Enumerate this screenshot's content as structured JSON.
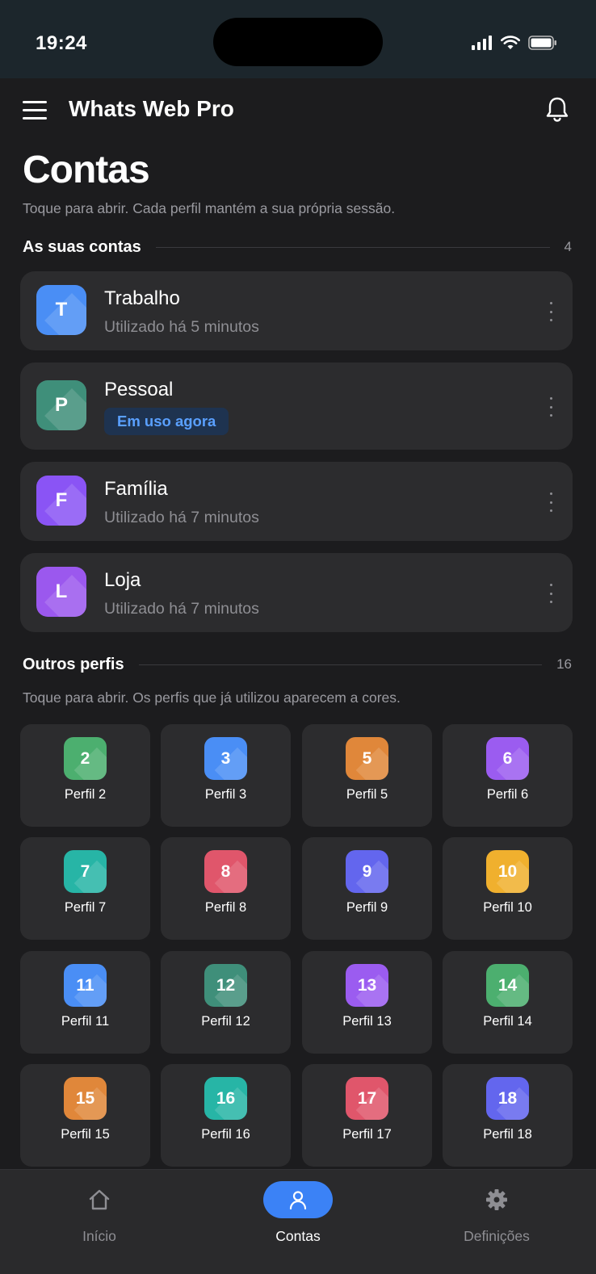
{
  "status_bar": {
    "time": "19:24"
  },
  "app": {
    "title": "Whats Web Pro"
  },
  "page": {
    "title": "Contas",
    "subtitle": "Toque para abrir. Cada perfil mantém a sua própria sessão."
  },
  "accounts_section": {
    "title": "As suas contas",
    "count": "4",
    "items": [
      {
        "initial": "T",
        "name": "Trabalho",
        "meta": "Utilizado há 5 minutos",
        "color": "#4a8ef5"
      },
      {
        "initial": "P",
        "name": "Pessoal",
        "badge": "Em uso agora",
        "color": "#3f8f7a"
      },
      {
        "initial": "F",
        "name": "Família",
        "meta": "Utilizado há 7 minutos",
        "color": "#8a54f5"
      },
      {
        "initial": "L",
        "name": "Loja",
        "meta": "Utilizado há 7 minutos",
        "color": "#9b58ee"
      }
    ]
  },
  "profiles_section": {
    "title": "Outros perfis",
    "count": "16",
    "description": "Toque para abrir. Os perfis que já utilizou aparecem a cores.",
    "items": [
      {
        "number": "2",
        "label": "Perfil 2",
        "color": "#4caf6f"
      },
      {
        "number": "3",
        "label": "Perfil 3",
        "color": "#4a8ef5"
      },
      {
        "number": "5",
        "label": "Perfil 5",
        "color": "#e0873a"
      },
      {
        "number": "6",
        "label": "Perfil 6",
        "color": "#9b5cf0"
      },
      {
        "number": "7",
        "label": "Perfil 7",
        "color": "#27b5a6"
      },
      {
        "number": "8",
        "label": "Perfil 8",
        "color": "#e0566b"
      },
      {
        "number": "9",
        "label": "Perfil 9",
        "color": "#6366ee"
      },
      {
        "number": "10",
        "label": "Perfil 10",
        "color": "#f0b02e"
      },
      {
        "number": "11",
        "label": "Perfil 11",
        "color": "#4a8ef5"
      },
      {
        "number": "12",
        "label": "Perfil 12",
        "color": "#3f8f7a"
      },
      {
        "number": "13",
        "label": "Perfil 13",
        "color": "#9b5cf0"
      },
      {
        "number": "14",
        "label": "Perfil 14",
        "color": "#4caf6f"
      },
      {
        "number": "15",
        "label": "Perfil 15",
        "color": "#e0873a"
      },
      {
        "number": "16",
        "label": "Perfil 16",
        "color": "#27b5a6"
      },
      {
        "number": "17",
        "label": "Perfil 17",
        "color": "#e0566b"
      },
      {
        "number": "18",
        "label": "Perfil 18",
        "color": "#6366ee"
      }
    ]
  },
  "bottom_nav": {
    "items": [
      {
        "label": "Início",
        "icon": "home-icon",
        "active": false
      },
      {
        "label": "Contas",
        "icon": "person-icon",
        "active": true
      },
      {
        "label": "Definições",
        "icon": "gear-icon",
        "active": false
      }
    ],
    "active_color": "#3b82f6"
  }
}
